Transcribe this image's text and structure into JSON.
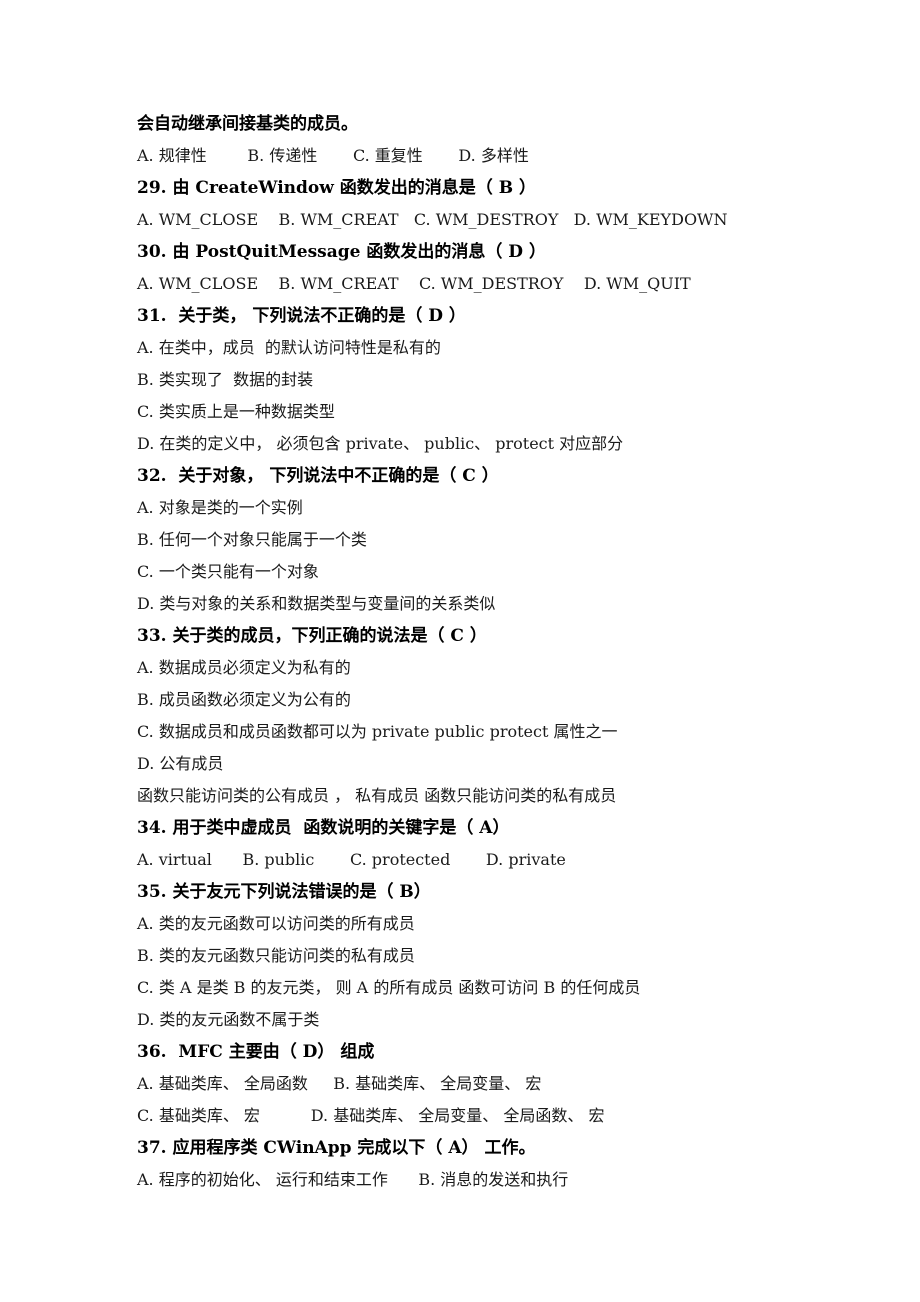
{
  "document": {
    "type": "exam-paper",
    "language": "zh-CN",
    "subject_hint": "C++ / MFC 选择题",
    "background_color": "#ffffff",
    "text_color": "#000000",
    "lines": [
      {
        "id": "l01",
        "style": "question",
        "text": "会自动继承间接基类的成员。"
      },
      {
        "id": "l02",
        "style": "option",
        "text": "A. 规律性        B. 传递性       C. 重复性       D. 多样性"
      },
      {
        "id": "l03",
        "style": "question",
        "text": "29. 由 CreateWindow 函数发出的消息是（ B ）"
      },
      {
        "id": "l04",
        "style": "option",
        "text": "A. WM_CLOSE    B. WM_CREAT   C. WM_DESTROY   D. WM_KEYDOWN"
      },
      {
        "id": "l05",
        "style": "question",
        "text": "30. 由 PostQuitMessage 函数发出的消息（ D ）"
      },
      {
        "id": "l06",
        "style": "option",
        "text": "A. WM_CLOSE    B. WM_CREAT    C. WM_DESTROY    D. WM_QUIT"
      },
      {
        "id": "l07",
        "style": "question",
        "text": "31.  关于类， 下列说法不正确的是（ D ）"
      },
      {
        "id": "l08",
        "style": "option",
        "text": "A. 在类中，成员  的默认访问特性是私有的"
      },
      {
        "id": "l09",
        "style": "option",
        "text": "B. 类实现了  数据的封装"
      },
      {
        "id": "l10",
        "style": "option",
        "text": "C. 类实质上是一种数据类型"
      },
      {
        "id": "l11",
        "style": "option",
        "text": "D. 在类的定义中， 必须包含 private、 public、 protect 对应部分"
      },
      {
        "id": "l12",
        "style": "question",
        "text": "32.  关于对象， 下列说法中不正确的是（ C ）"
      },
      {
        "id": "l13",
        "style": "option",
        "text": "A. 对象是类的一个实例"
      },
      {
        "id": "l14",
        "style": "option",
        "text": "B. 任何一个对象只能属于一个类"
      },
      {
        "id": "l15",
        "style": "option",
        "text": "C. 一个类只能有一个对象"
      },
      {
        "id": "l16",
        "style": "option",
        "text": "D. 类与对象的关系和数据类型与变量间的关系类似"
      },
      {
        "id": "l17",
        "style": "question",
        "text": "33. 关于类的成员，下列正确的说法是（ C ）"
      },
      {
        "id": "l18",
        "style": "option",
        "text": "A. 数据成员必须定义为私有的"
      },
      {
        "id": "l19",
        "style": "option",
        "text": "B. 成员函数必须定义为公有的"
      },
      {
        "id": "l20",
        "style": "option",
        "text": "C. 数据成员和成员函数都可以为 private public protect 属性之一"
      },
      {
        "id": "l21",
        "style": "option",
        "text": "D. 公有成员"
      },
      {
        "id": "l22",
        "style": "option",
        "text": "函数只能访问类的公有成员 ， 私有成员 函数只能访问类的私有成员"
      },
      {
        "id": "l23",
        "style": "question",
        "text": "34. 用于类中虚成员  函数说明的关键字是（ A）"
      },
      {
        "id": "l24",
        "style": "option",
        "text": "A. virtual      B. public       C. protected       D. private"
      },
      {
        "id": "l25",
        "style": "question",
        "text": "35. 关于友元下列说法错误的是（ B）"
      },
      {
        "id": "l26",
        "style": "option",
        "text": "A. 类的友元函数可以访问类的所有成员"
      },
      {
        "id": "l27",
        "style": "option",
        "text": "B. 类的友元函数只能访问类的私有成员"
      },
      {
        "id": "l28",
        "style": "option",
        "text": "C. 类 A 是类 B 的友元类， 则 A 的所有成员 函数可访问 B 的任何成员"
      },
      {
        "id": "l29",
        "style": "option",
        "text": "D. 类的友元函数不属于类"
      },
      {
        "id": "l30",
        "style": "question",
        "text": "36.  MFC 主要由（ D） 组成"
      },
      {
        "id": "l31",
        "style": "option",
        "text": "A. 基础类库、 全局函数     B. 基础类库、 全局变量、 宏"
      },
      {
        "id": "l32",
        "style": "option",
        "text": "C. 基础类库、 宏          D. 基础类库、 全局变量、 全局函数、 宏"
      },
      {
        "id": "l33",
        "style": "question",
        "text": "37. 应用程序类 CWinApp 完成以下（ A） 工作。"
      },
      {
        "id": "l34",
        "style": "option",
        "text": "A. 程序的初始化、 运行和结束工作      B. 消息的发送和执行"
      }
    ]
  }
}
